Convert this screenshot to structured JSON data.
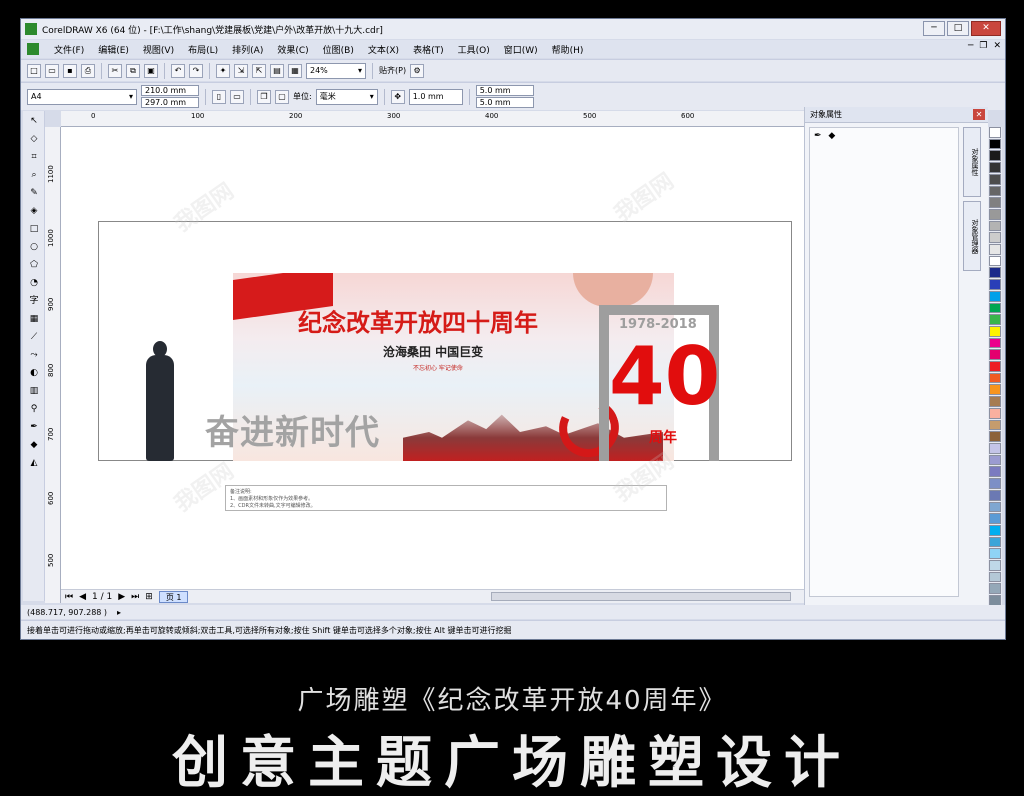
{
  "window": {
    "title": "CorelDRAW X6 (64 位) - [F:\\工作\\shang\\党建展板\\党建\\户外\\改革开放\\十九大.cdr]"
  },
  "menu": [
    "文件(F)",
    "编辑(E)",
    "视图(V)",
    "布局(L)",
    "排列(A)",
    "效果(C)",
    "位图(B)",
    "文本(X)",
    "表格(T)",
    "工具(O)",
    "窗口(W)",
    "帮助(H)"
  ],
  "toolbar1": {
    "zoom": "24%",
    "snap": "贴齐(P)"
  },
  "toolbar2": {
    "page_size": "A4",
    "width": "210.0 mm",
    "height": "297.0 mm",
    "unit_label": "单位:",
    "unit": "毫米",
    "nudge": "1.0 mm",
    "dup_x": "5.0 mm",
    "dup_y": "5.0 mm"
  },
  "hruler": [
    "0",
    "100",
    "200",
    "300",
    "400",
    "500",
    "600"
  ],
  "vruler": [
    "1100",
    "1000",
    "900",
    "800",
    "700",
    "600",
    "500"
  ],
  "canvas": {
    "banner_title": "纪念改革开放四十周年",
    "banner_subtitle": "沧海桑田  中国巨变",
    "banner_small": "不忘初心 牢记使命",
    "slogan": "奋进新时代",
    "years": "1978-2018",
    "big_number": "40",
    "anniversary": "周年",
    "notes_title": "备注说明:",
    "notes_l1": "1、画面素材和形象仅作为效果参考。",
    "notes_l2": "2、CDR文件未转曲,文字可编辑修改。"
  },
  "pager": {
    "count": "1 / 1",
    "tab": "页 1"
  },
  "docker": {
    "title": "对象属性",
    "tab1": "对象属性",
    "tab2": "对象管理器"
  },
  "status": {
    "coords": "(488.717, 907.288 )",
    "hint": "接着单击可进行拖动或缩放;再单击可旋转或倾斜;双击工具,可选择所有对象;按住 Shift 键单击可选择多个对象;按住 Alt 键单击可进行挖掘"
  },
  "palette": [
    "#ffffff",
    "#000000",
    "#1a1a1a",
    "#333333",
    "#4d4d4d",
    "#666666",
    "#808080",
    "#999999",
    "#b3b3b3",
    "#cccccc",
    "#e6e6e6",
    "#ffffff",
    "#1b2a8a",
    "#2a3fb8",
    "#00a0e9",
    "#00a651",
    "#39b54a",
    "#fff200",
    "#ec008c",
    "#e4006e",
    "#ed1c24",
    "#f15a24",
    "#f7941d",
    "#a67c52",
    "#f9b09f",
    "#c69c6d",
    "#8c6239",
    "#c4c4e8",
    "#9b9bd1",
    "#7b7bc0",
    "#7c8fc6",
    "#6b79b3",
    "#7fa7d1",
    "#5b9bd5",
    "#00aeef",
    "#3ca5d8",
    "#8fd3f5",
    "#bfd8e8",
    "#b4c8d6",
    "#94a8b8",
    "#7c8d9c"
  ],
  "caption": "广场雕塑《纪念改革开放40周年》",
  "headline": "创意主题广场雕塑设计"
}
